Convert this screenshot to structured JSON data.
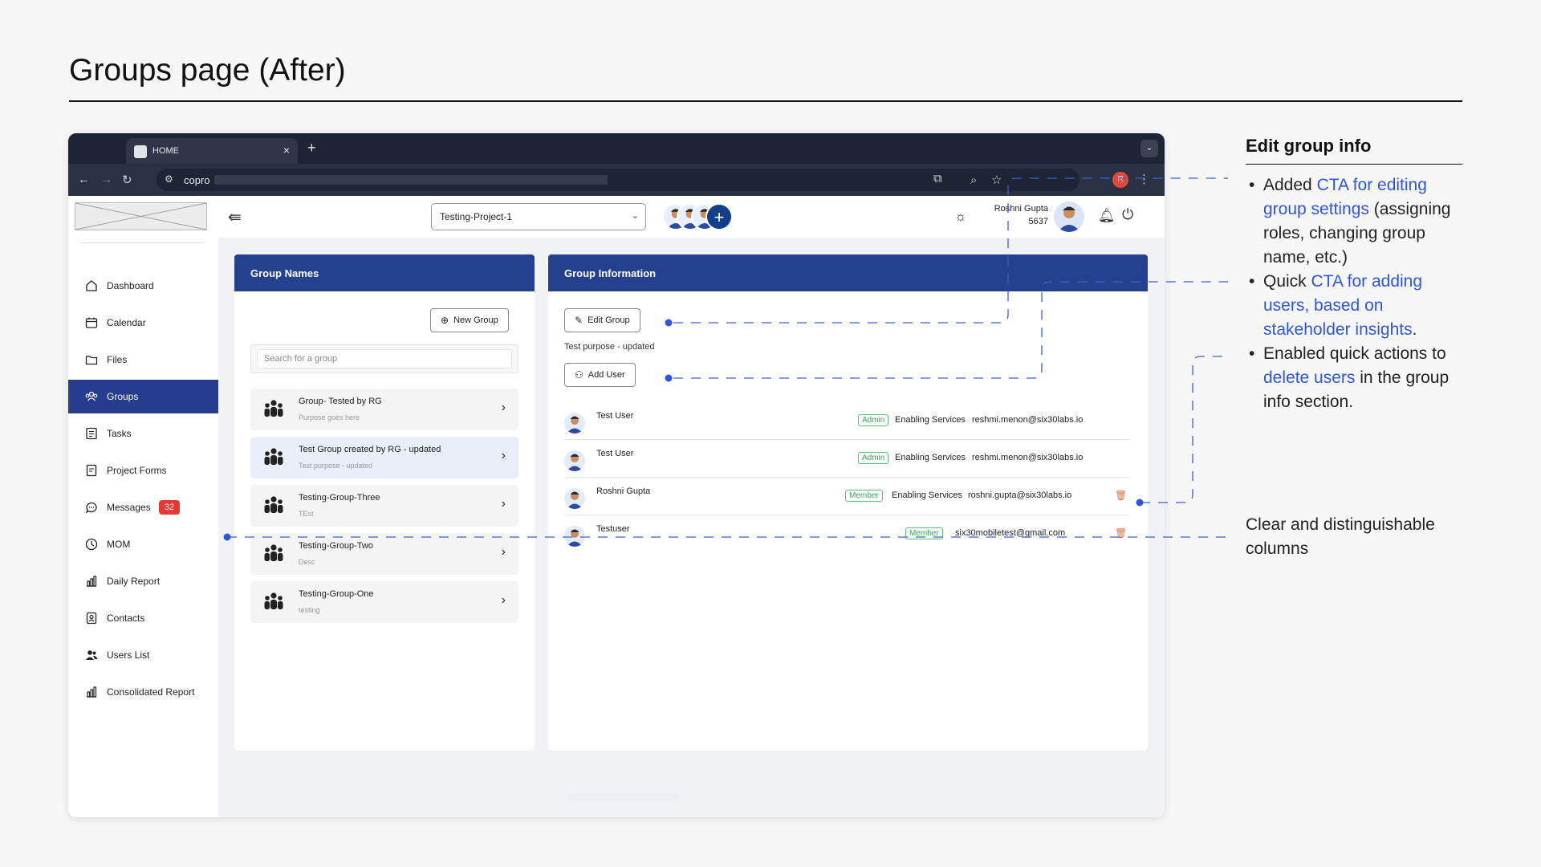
{
  "page": {
    "title": "Groups page (After)"
  },
  "browser": {
    "tab_title": "HOME",
    "tab_close": "×",
    "new_tab": "+",
    "tab_menu": "⌄",
    "url_text": "copro",
    "profile_initial": "R"
  },
  "sidebar": {
    "items": [
      {
        "label": "Dashboard",
        "icon": "home-icon"
      },
      {
        "label": "Calendar",
        "icon": "calendar-icon"
      },
      {
        "label": "Files",
        "icon": "folder-icon"
      },
      {
        "label": "Groups",
        "icon": "groups-icon",
        "active": true
      },
      {
        "label": "Tasks",
        "icon": "tasks-icon"
      },
      {
        "label": "Project Forms",
        "icon": "form-icon"
      },
      {
        "label": "Messages",
        "icon": "chat-icon",
        "badge": "32"
      },
      {
        "label": "MOM",
        "icon": "clock-icon"
      },
      {
        "label": "Daily Report",
        "icon": "bar-chart-icon"
      },
      {
        "label": "Contacts",
        "icon": "contacts-icon"
      },
      {
        "label": "Users List",
        "icon": "users-icon"
      },
      {
        "label": "Consolidated Report",
        "icon": "bar-chart-icon"
      }
    ]
  },
  "topbar": {
    "project": "Testing-Project-1",
    "add_member": "+",
    "user_name": "Roshni Gupta",
    "user_id": "5637"
  },
  "groups_panel": {
    "title": "Group Names",
    "new_group_label": "New Group",
    "search_placeholder": "Search for a group",
    "groups": [
      {
        "name": "Group- Tested by RG",
        "desc": "Purpose goes here"
      },
      {
        "name": "Test Group created by RG - updated",
        "desc": "Test purpose - updated",
        "selected": true
      },
      {
        "name": "Testing-Group-Three",
        "desc": "TEst"
      },
      {
        "name": "Testing-Group-Two",
        "desc": "Desc"
      },
      {
        "name": "Testing-Group-One",
        "desc": "testing"
      }
    ]
  },
  "info_panel": {
    "title": "Group Information",
    "edit_label": "Edit Group",
    "purpose": "Test purpose - updated",
    "add_user_label": "Add User",
    "users": [
      {
        "name": "Test User",
        "role": "Admin",
        "dept": "Enabling Services",
        "email": "reshmi.menon@six30labs.io",
        "deletable": false
      },
      {
        "name": "Test User",
        "role": "Admin",
        "dept": "Enabling Services",
        "email": "reshmi.menon@six30labs.io",
        "deletable": false
      },
      {
        "name": "Roshni Gupta",
        "role": "Member",
        "dept": "Enabling Services",
        "email": "roshni.gupta@six30labs.io",
        "deletable": true
      },
      {
        "name": "Testuser",
        "role": "Member",
        "dept": "",
        "email": "six30mobiletest@gmail.com",
        "deletable": true
      }
    ]
  },
  "annotations": {
    "heading": "Edit group info",
    "bullets": [
      [
        {
          "t": "Added "
        },
        {
          "t": "CTA for editing group settings",
          "hl": true
        },
        {
          "t": " (assigning roles, changing group name, etc.)"
        }
      ],
      [
        {
          "t": "Quick "
        },
        {
          "t": "CTA for adding users, based on stakeholder insights",
          "hl": true
        },
        {
          "t": "."
        }
      ],
      [
        {
          "t": "Enabled quick actions to "
        },
        {
          "t": "delete users",
          "hl": true
        },
        {
          "t": " in the group info section."
        }
      ]
    ],
    "columns_note": "Clear and distinguishable columns"
  },
  "colors": {
    "accent": "#25408f",
    "annotation_blue": "#2f56d8",
    "badge_red": "#e53935",
    "role_green": "#3aa757"
  }
}
